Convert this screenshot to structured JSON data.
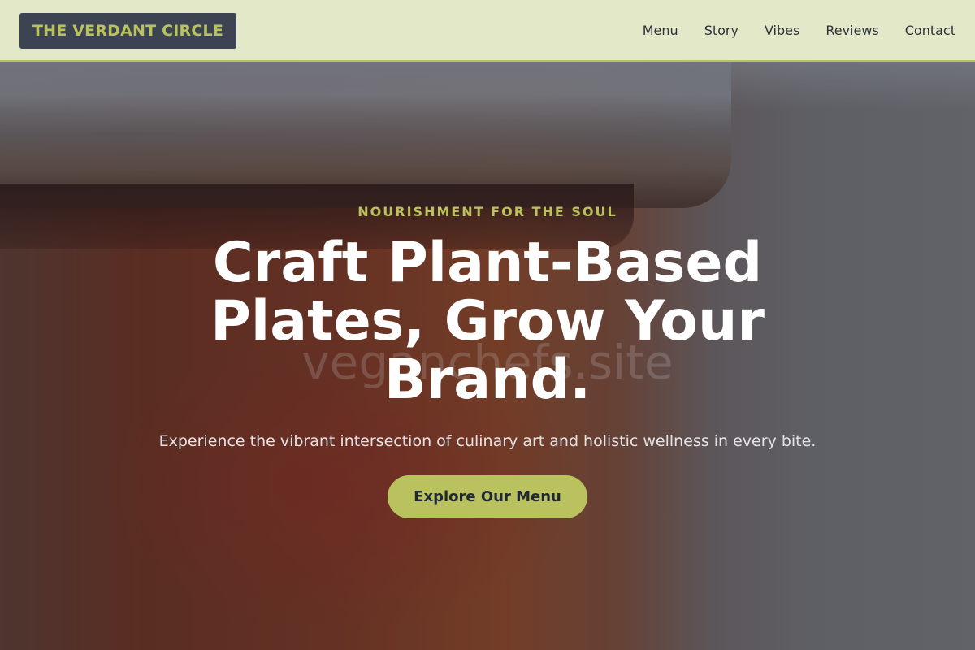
{
  "header": {
    "logo_text": "THE VERDANT CIRCLE",
    "nav": [
      {
        "label": "Menu"
      },
      {
        "label": "Story"
      },
      {
        "label": "Vibes"
      },
      {
        "label": "Reviews"
      },
      {
        "label": "Contact"
      }
    ]
  },
  "hero": {
    "eyebrow": "NOURISHMENT FOR THE SOUL",
    "title": "Craft Plant-Based Plates, Grow Your Brand.",
    "subtitle": "Experience the vibrant intersection of culinary art and holistic wellness in every bite.",
    "cta_label": "Explore Our Menu",
    "watermark": "veganchefs.site"
  },
  "colors": {
    "header_bg": "#e3e8c8",
    "logo_bg": "#3d4451",
    "accent": "#b9c25e",
    "text_dark": "#2d323a",
    "title_white": "#ffffff"
  }
}
